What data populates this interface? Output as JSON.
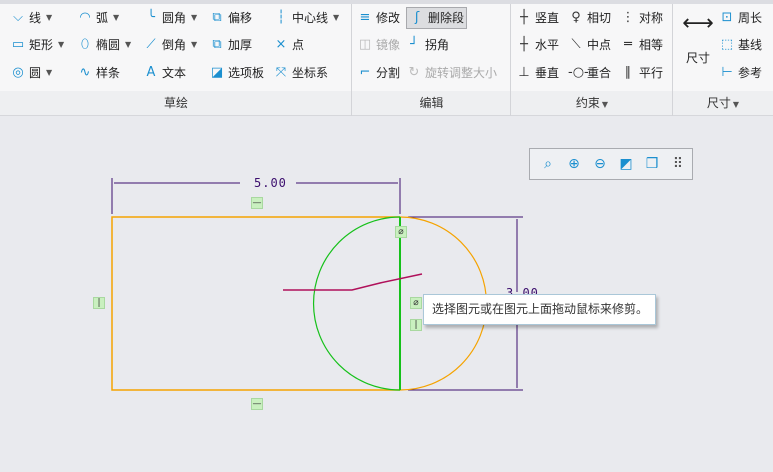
{
  "groups": {
    "sketch": {
      "label": "草绘",
      "items": [
        {
          "label": "线",
          "icon": "line-icon",
          "dd": true
        },
        {
          "label": "弧",
          "icon": "arc-icon",
          "dd": true
        },
        {
          "label": "圆角",
          "icon": "fillet-icon",
          "dd": true
        },
        {
          "label": "偏移",
          "icon": "offset-icon"
        },
        {
          "label": "中心线",
          "icon": "centerline-icon",
          "dd": true
        },
        {
          "label": "矩形",
          "icon": "rectangle-icon",
          "dd": true
        },
        {
          "label": "椭圆",
          "icon": "ellipse-icon",
          "dd": true
        },
        {
          "label": "倒角",
          "icon": "chamfer-icon",
          "dd": true
        },
        {
          "label": "加厚",
          "icon": "thicken-icon"
        },
        {
          "label": "点",
          "icon": "point-icon"
        },
        {
          "label": "圆",
          "icon": "circle-icon",
          "dd": true
        },
        {
          "label": "样条",
          "icon": "spline-icon"
        },
        {
          "label": "文本",
          "icon": "text-icon"
        },
        {
          "label": "选项板",
          "icon": "palette-icon"
        },
        {
          "label": "坐标系",
          "icon": "coordinate-system-icon"
        }
      ]
    },
    "edit": {
      "label": "编辑",
      "items": [
        {
          "label": "修改",
          "icon": "modify-icon"
        },
        {
          "label": "删除段",
          "icon": "delete-segment-icon",
          "selected": true
        },
        {
          "label": "镜像",
          "icon": "mirror-icon",
          "disabled": true
        },
        {
          "label": "拐角",
          "icon": "corner-icon"
        },
        {
          "label": "分割",
          "icon": "divide-icon"
        },
        {
          "label": "旋转调整大小",
          "icon": "rotate-resize-icon",
          "disabled": true
        }
      ]
    },
    "constrain": {
      "label": "约束",
      "items": [
        {
          "label": "竖直",
          "icon": "vertical-icon"
        },
        {
          "label": "相切",
          "icon": "tangent-icon"
        },
        {
          "label": "对称",
          "icon": "symmetric-icon"
        },
        {
          "label": "水平",
          "icon": "horizontal-icon"
        },
        {
          "label": "中点",
          "icon": "midpoint-icon"
        },
        {
          "label": "相等",
          "icon": "equal-icon"
        },
        {
          "label": "垂直",
          "icon": "perpendicular-icon"
        },
        {
          "label": "重合",
          "icon": "coincident-icon"
        },
        {
          "label": "平行",
          "icon": "parallel-icon"
        }
      ]
    },
    "dimension": {
      "label": "尺寸",
      "big": "尺寸",
      "items": [
        {
          "label": "周长",
          "icon": "perimeter-icon"
        },
        {
          "label": "基线",
          "icon": "baseline-icon"
        },
        {
          "label": "参考",
          "icon": "reference-icon"
        }
      ]
    }
  },
  "canvas": {
    "dim_width": "5.00",
    "dim_height": "3.00",
    "tooltip": "选择图元或在图元上面拖动鼠标来修剪。"
  },
  "colors": {
    "orange": "#f5a300",
    "green": "#16c11a",
    "dim": "#3c0f6e",
    "trim": "#b0105a"
  }
}
